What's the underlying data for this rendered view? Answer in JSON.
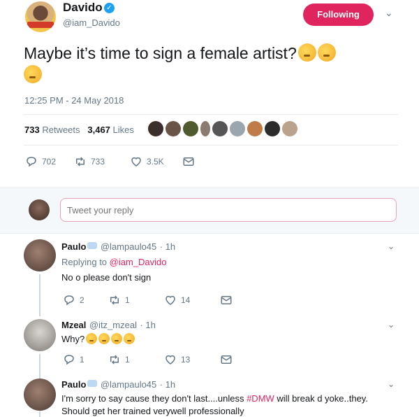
{
  "tweet": {
    "author_name": "Davido",
    "author_handle": "@iam_Davido",
    "follow_label": "Following",
    "text": "Maybe it’s time to sign a female artist?",
    "emoji_names": [
      "thinking-face",
      "thinking-face",
      "thinking-face"
    ],
    "timestamp": "12:25 PM - 24 May 2018",
    "stats": {
      "retweets_count": "733",
      "retweets_label": "Retweets",
      "likes_count": "3,467",
      "likes_label": "Likes"
    },
    "actions": {
      "replies": "702",
      "retweets": "733",
      "likes": "3.5K"
    }
  },
  "reply_box": {
    "placeholder": "Tweet your reply"
  },
  "replies": [
    {
      "name": "Paulo",
      "handle": "@lampaulo45",
      "time": "1h",
      "replying_prefix": "Replying to",
      "replying_to": "@iam_Davido",
      "text": "No o please don't sign",
      "actions": {
        "replies": "2",
        "retweets": "1",
        "likes": "14"
      }
    },
    {
      "name": "Mzeal",
      "handle": "@itz_mzeal",
      "time": "1h",
      "text": "Why?",
      "emoji_names": [
        "anguished-face",
        "anguished-face",
        "grimacing-face",
        "grimacing-face"
      ],
      "actions": {
        "replies": "1",
        "retweets": "1",
        "likes": "13"
      }
    },
    {
      "name": "Paulo",
      "handle": "@lampaulo45",
      "time": "1h",
      "text_before": "I'm sorry to say cause they don't last....unless ",
      "hashtag": "#DMW",
      "text_after": " will break d yoke..they.",
      "text_line2": "Should get her trained verywell professionally"
    }
  ],
  "colors": {
    "accent": "#e0245e",
    "verified": "#1da1f2",
    "muted": "#657786"
  }
}
